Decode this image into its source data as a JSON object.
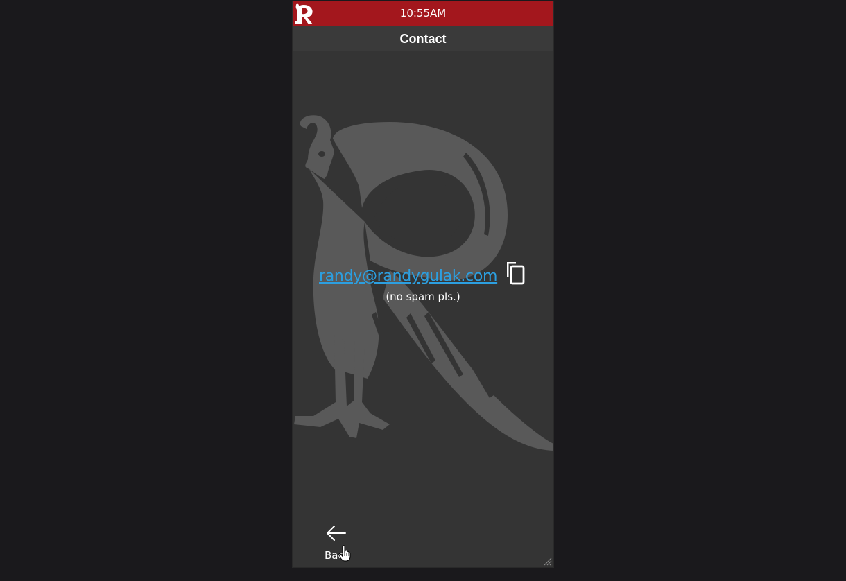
{
  "status_bar": {
    "time": "10:55AM",
    "logo_icon": "rooster-r-logo-icon",
    "color": "#a3171d"
  },
  "header": {
    "title": "Contact"
  },
  "contact": {
    "email": "randy@randygulak.com",
    "note": "(no spam pls.)",
    "copy_icon": "copy-icon",
    "link_color": "#2c9fe0"
  },
  "navigation": {
    "back_label": "Back",
    "back_icon": "arrow-left-icon"
  },
  "background": {
    "logo": "rooster-r-watermark",
    "page_color": "#1a191c",
    "panel_color": "#343434"
  }
}
